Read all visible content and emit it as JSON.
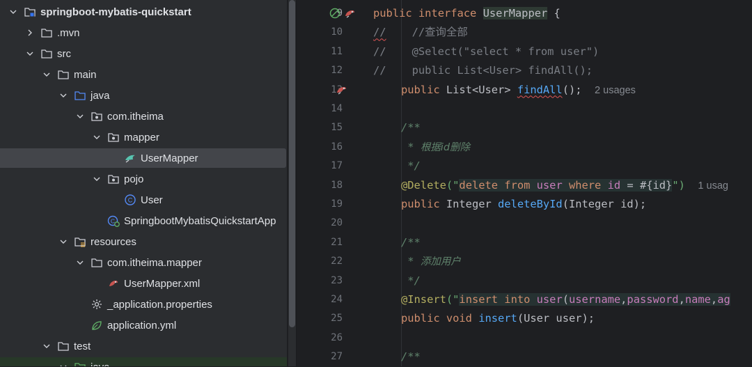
{
  "project_tree": {
    "items": [
      {
        "label": "springboot-mybatis-quickstart",
        "icon": "module-folder-icon",
        "expanded": true,
        "depth": 0,
        "bold": true
      },
      {
        "label": ".mvn",
        "icon": "folder-icon",
        "expanded": false,
        "depth": 1
      },
      {
        "label": "src",
        "icon": "folder-icon",
        "expanded": true,
        "depth": 1
      },
      {
        "label": "main",
        "icon": "folder-icon",
        "expanded": true,
        "depth": 2
      },
      {
        "label": "java",
        "icon": "source-root-folder-icon",
        "expanded": true,
        "depth": 3
      },
      {
        "label": "com.itheima",
        "icon": "package-icon",
        "expanded": true,
        "depth": 4
      },
      {
        "label": "mapper",
        "icon": "package-icon",
        "expanded": true,
        "depth": 5
      },
      {
        "label": "UserMapper",
        "icon": "mybatis-mapper-interface-icon",
        "expanded": null,
        "depth": 6,
        "selected": true
      },
      {
        "label": "pojo",
        "icon": "package-icon",
        "expanded": true,
        "depth": 5
      },
      {
        "label": "User",
        "icon": "java-class-icon",
        "expanded": null,
        "depth": 6
      },
      {
        "label": "SpringbootMybatisQuickstartApp",
        "icon": "spring-boot-class-icon",
        "expanded": null,
        "depth": 5
      },
      {
        "label": "resources",
        "icon": "resources-folder-icon",
        "expanded": true,
        "depth": 3
      },
      {
        "label": "com.itheima.mapper",
        "icon": "folder-icon",
        "expanded": true,
        "depth": 4
      },
      {
        "label": "UserMapper.xml",
        "icon": "mybatis-xml-icon",
        "expanded": null,
        "depth": 5
      },
      {
        "label": "_application.properties",
        "icon": "gear-icon",
        "expanded": null,
        "depth": 4
      },
      {
        "label": "application.yml",
        "icon": "spring-leaf-icon",
        "expanded": null,
        "depth": 4
      },
      {
        "label": "test",
        "icon": "folder-icon",
        "expanded": true,
        "depth": 2
      },
      {
        "label": "java",
        "icon": "test-source-folder-icon",
        "expanded": true,
        "depth": 3
      }
    ]
  },
  "editor": {
    "lines": [
      {
        "num": "9"
      },
      {
        "num": "10"
      },
      {
        "num": "11"
      },
      {
        "num": "12"
      },
      {
        "num": "13"
      },
      {
        "num": "14"
      },
      {
        "num": "15"
      },
      {
        "num": "16"
      },
      {
        "num": "17"
      },
      {
        "num": "18"
      },
      {
        "num": "19"
      },
      {
        "num": "20"
      },
      {
        "num": "21"
      },
      {
        "num": "22"
      },
      {
        "num": "23"
      },
      {
        "num": "24"
      },
      {
        "num": "25"
      },
      {
        "num": "26"
      },
      {
        "num": "27"
      }
    ],
    "code": {
      "l9_public": "public",
      "l9_interface": "interface",
      "l9_name": "UserMapper",
      "l9_brace": " {",
      "l10_slash": "//",
      "l10_comment": "    //查询全部",
      "l11": "//    @Select(\"select * from user\")",
      "l12": "//    public List<User> findAll();",
      "l13_public": "public",
      "l13_type": " List<User> ",
      "l13_fn": "findAll",
      "l13_rest": "();",
      "l13_hint": "2 usages",
      "l15": "/**",
      "l16_star": " * ",
      "l16_text": "根据id删除",
      "l17": " */",
      "l18_ann": "@Delete",
      "l18_open": "(\"",
      "l18_del": "delete",
      "l18_from": " from ",
      "l18_user": "user",
      "l18_where": " where ",
      "l18_id": "id",
      "l18_eq": " = #{",
      "l18_id2": "id",
      "l18_close": "}",
      "l18_end": "\")",
      "l18_hint": "1 usag",
      "l19_public": "public",
      "l19_type": " Integer ",
      "l19_fn": "deleteById",
      "l19_rest": "(Integer id);",
      "l21": "/**",
      "l22_star": " * ",
      "l22_text": "添加用户",
      "l23": " */",
      "l24_ann": "@Insert",
      "l24_open": "(\"",
      "l24_ins": "insert",
      "l24_into": " into ",
      "l24_user": "user",
      "l24_paren": "(",
      "l24_c1": "username",
      "l24_comma1": ",",
      "l24_c2": "password",
      "l24_comma2": ",",
      "l24_c3": "name",
      "l24_comma3": ",",
      "l24_c4": "ag",
      "l25_public": "public",
      "l25_void": " void ",
      "l25_fn": "insert",
      "l25_rest": "(User user);",
      "l27": "/**"
    }
  },
  "colors": {
    "keyword": "#cf8e6d",
    "comment": "#7a7e85",
    "doc": "#5f826b",
    "annotation": "#b3ae60",
    "string": "#6aab73",
    "function": "#56a8f5",
    "sql_table": "#c77dbb",
    "selection": "#43454a"
  }
}
